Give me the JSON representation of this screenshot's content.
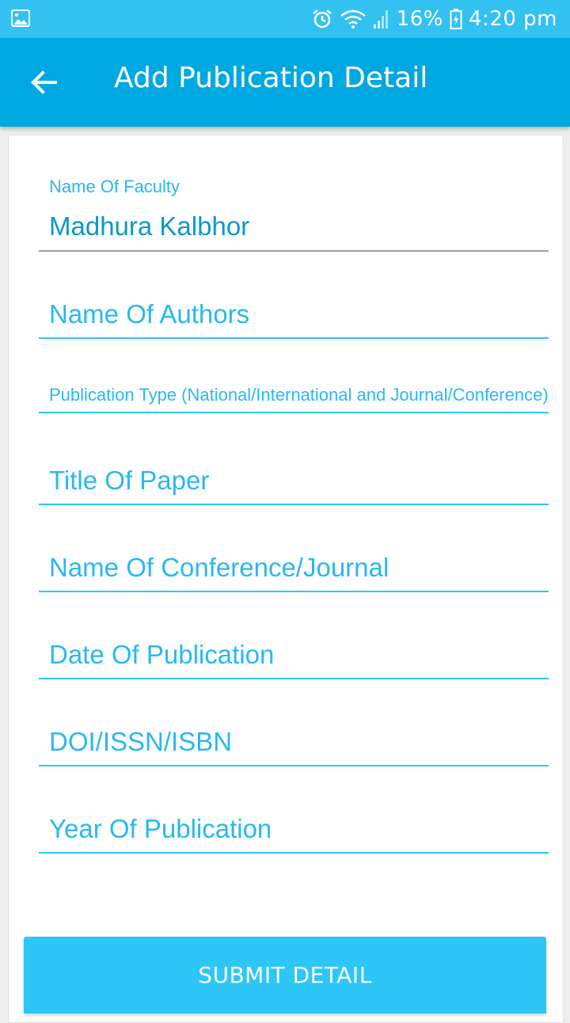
{
  "status_bar": {
    "battery_percent": "16%",
    "time": "4:20 pm",
    "icons": [
      "gallery-icon",
      "alarm-icon",
      "wifi-icon",
      "signal-icon",
      "battery-icon"
    ]
  },
  "app_bar": {
    "title": "Add Publication Detail",
    "back_icon": "arrow-left-icon"
  },
  "form": {
    "faculty": {
      "label": "Name Of Faculty",
      "value": "Madhura Kalbhor"
    },
    "authors": {
      "placeholder": "Name Of Authors"
    },
    "publication_type": {
      "placeholder": "Publication Type (National/International and Journal/Conference)"
    },
    "title_of_paper": {
      "placeholder": "Title Of Paper"
    },
    "conference_journal": {
      "placeholder": "Name Of Conference/Journal"
    },
    "date_of_publication": {
      "placeholder": "Date Of Publication"
    },
    "doi_issn_isbn": {
      "placeholder": "DOI/ISSN/ISBN"
    },
    "year_of_publication": {
      "placeholder": "Year Of Publication"
    }
  },
  "submit": {
    "label": "SUBMIT DETAIL"
  },
  "colors": {
    "status_bar": "#33c1f2",
    "app_bar": "#00a8e1",
    "accent": "#2ec6f4",
    "button": "#2ec6f7"
  }
}
